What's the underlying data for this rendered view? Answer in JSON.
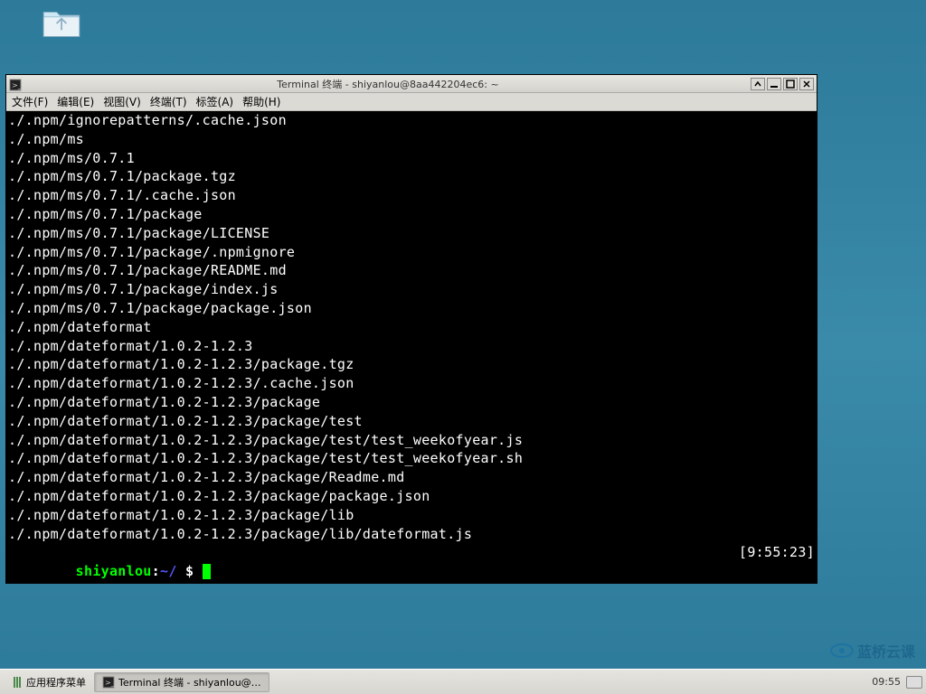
{
  "desktop": {
    "folder_icon": "home-folder-icon"
  },
  "window": {
    "title": "Terminal 终端 - shiyanlou@8aa442204ec6: ~"
  },
  "menubar": {
    "file": "文件(F)",
    "edit": "编辑(E)",
    "view": "视图(V)",
    "terminal": "终端(T)",
    "tabs": "标签(A)",
    "help": "帮助(H)"
  },
  "terminal": {
    "lines": [
      "./.npm/ignorepatterns/.cache.json",
      "./.npm/ms",
      "./.npm/ms/0.7.1",
      "./.npm/ms/0.7.1/package.tgz",
      "./.npm/ms/0.7.1/.cache.json",
      "./.npm/ms/0.7.1/package",
      "./.npm/ms/0.7.1/package/LICENSE",
      "./.npm/ms/0.7.1/package/.npmignore",
      "./.npm/ms/0.7.1/package/README.md",
      "./.npm/ms/0.7.1/package/index.js",
      "./.npm/ms/0.7.1/package/package.json",
      "./.npm/dateformat",
      "./.npm/dateformat/1.0.2-1.2.3",
      "./.npm/dateformat/1.0.2-1.2.3/package.tgz",
      "./.npm/dateformat/1.0.2-1.2.3/.cache.json",
      "./.npm/dateformat/1.0.2-1.2.3/package",
      "./.npm/dateformat/1.0.2-1.2.3/package/test",
      "./.npm/dateformat/1.0.2-1.2.3/package/test/test_weekofyear.js",
      "./.npm/dateformat/1.0.2-1.2.3/package/test/test_weekofyear.sh",
      "./.npm/dateformat/1.0.2-1.2.3/package/Readme.md",
      "./.npm/dateformat/1.0.2-1.2.3/package/package.json",
      "./.npm/dateformat/1.0.2-1.2.3/package/lib",
      "./.npm/dateformat/1.0.2-1.2.3/package/lib/dateformat.js"
    ],
    "prompt": {
      "user": "shiyanlou",
      "sep": ":",
      "path": "~/",
      "dollar": " $ ",
      "time": "[9:55:23]"
    }
  },
  "taskbar": {
    "app_menu": "应用程序菜单",
    "task": "Terminal 终端 - shiyanlou@…",
    "clock": "09:55"
  },
  "watermark": "蓝桥云课"
}
